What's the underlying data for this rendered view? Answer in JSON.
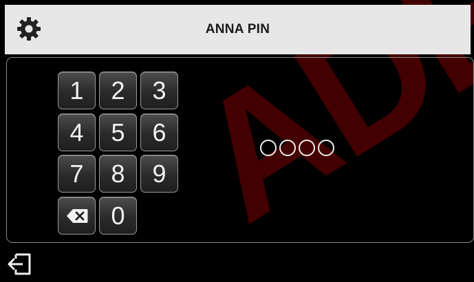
{
  "header": {
    "title": "ANNA PIN",
    "settings_icon": "gear-icon"
  },
  "keypad": {
    "keys": [
      "1",
      "2",
      "3",
      "4",
      "5",
      "6",
      "7",
      "8",
      "9",
      "0"
    ],
    "backspace_icon": "backspace-icon"
  },
  "pin": {
    "length": 4,
    "entered": 0
  },
  "footer": {
    "logout_icon": "logout-icon"
  },
  "watermark": "ADER",
  "colors": {
    "header_bg": "#e7e7e7",
    "background": "#000000",
    "key_border": "#9a9a9a",
    "watermark": "#5a0000"
  }
}
